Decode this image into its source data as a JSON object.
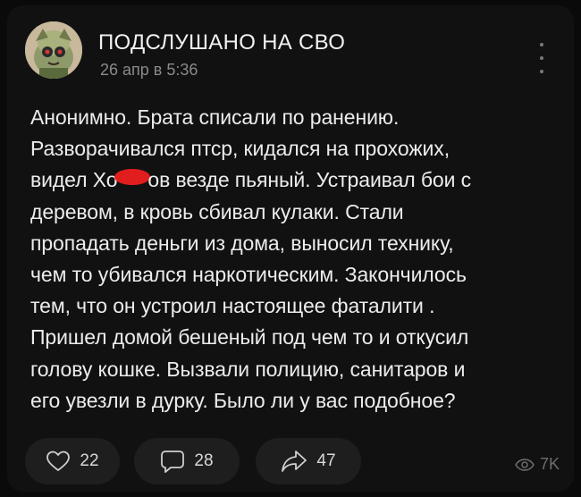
{
  "header": {
    "title": "ПОДСЛУШАНО НА СВО",
    "date": "26 апр в 5:36"
  },
  "post": {
    "lines": [
      "Анонимно. Брата списали по ранению.",
      "Разворачивался птср, кидался на прохожих,",
      "видел Хо",
      "ов везде пьяный. Устраивал бои с",
      "деревом, в кровь сбивал кулаки. Стали",
      "пропадать деньги из дома, выносил технику,",
      "чем то убивался наркотическим. Закончилось",
      "тем, что он устроил настоящее фаталити .",
      "Пришел домой бешеный под чем то и откусил",
      "голову кошке. Вызвали полицию,  санитаров и",
      "его увезли в дурку. Было ли у вас подобное?"
    ],
    "redaction_color": "#e21d1d"
  },
  "actions": {
    "likes": "22",
    "comments": "28",
    "shares": "47"
  },
  "stats": {
    "views": "7K"
  },
  "icons": {
    "like": "heart-icon",
    "comment": "comment-bubble-icon",
    "share": "share-arrow-icon",
    "views": "eye-icon",
    "menu": "kebab-menu-icon"
  },
  "colors": {
    "background": "#0a0a0a",
    "card": "#111111",
    "pill": "#1e1e1e",
    "muted_text": "#8a8a8a"
  }
}
